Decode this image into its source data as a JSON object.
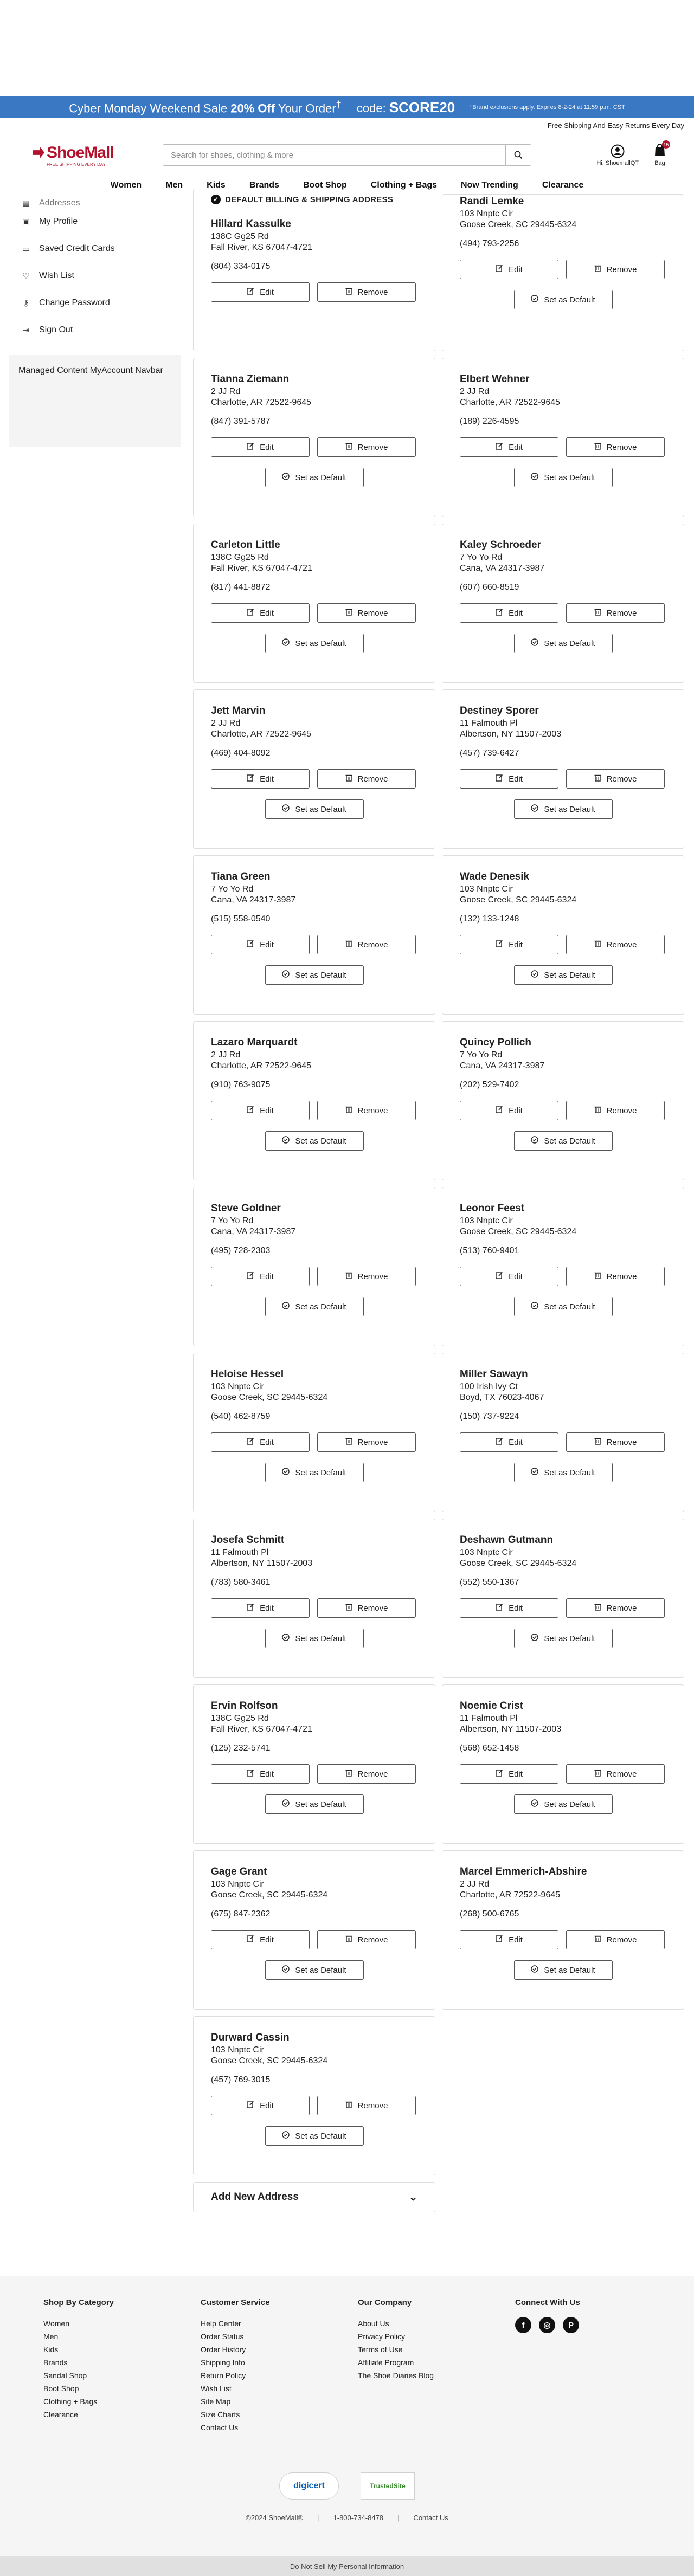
{
  "promo": {
    "sale": "Cyber Monday Weekend Sale",
    "pct": "20% Off",
    "order": "Your Order",
    "sup": "†",
    "code_label": "code:",
    "code": "SCORE20",
    "fine": "†Brand exclusions apply. Expires 8-2-24 at 11:59 p.m. CST"
  },
  "strip": {
    "right": "Free Shipping And Easy Returns Every Day"
  },
  "header": {
    "logo": "ShoeMall",
    "logo_tag": "FREE SHIPPING EVERY DAY",
    "search_placeholder": "Search for shoes, clothing & more",
    "account_label": "Hi, ShoemallQT",
    "bag_label": "Bag",
    "bag_count": "15"
  },
  "nav": [
    "Women",
    "Men",
    "Kids",
    "Brands",
    "Boot Shop",
    "Clothing + Bags",
    "Now Trending",
    "Clearance"
  ],
  "sidebar": {
    "partial_item": "Addresses",
    "items": [
      {
        "label": "My Profile",
        "icon": "profile-icon"
      },
      {
        "label": "Saved Credit Cards",
        "icon": "credit-card-icon"
      },
      {
        "label": "Wish List",
        "icon": "heart-icon"
      },
      {
        "label": "Change Password",
        "icon": "key-icon"
      },
      {
        "label": "Sign Out",
        "icon": "sign-out-icon"
      }
    ],
    "managed": "Managed Content MyAccount Navbar"
  },
  "labels": {
    "default_title": "DEFAULT BILLING & SHIPPING ADDRESS",
    "edit": "Edit",
    "remove": "Remove",
    "set_default": "Set as Default",
    "add_new": "Add New Address"
  },
  "addresses": [
    {
      "name": "Hillard Kassulke",
      "line1": "138C Gg25 Rd",
      "line2": "Fall River, KS 67047-4721",
      "phone": "(804) 334-0175",
      "is_default": true
    },
    {
      "name": "Randi Lemke",
      "line1": "103 Nnptc Cir",
      "line2": "Goose Creek, SC 29445-6324",
      "phone": "(494) 793-2256"
    },
    {
      "name": "Tianna Ziemann",
      "line1": "2 JJ Rd",
      "line2": "Charlotte, AR 72522-9645",
      "phone": "(847) 391-5787"
    },
    {
      "name": "Elbert Wehner",
      "line1": "2 JJ Rd",
      "line2": "Charlotte, AR 72522-9645",
      "phone": "(189) 226-4595"
    },
    {
      "name": "Carleton Little",
      "line1": "138C Gg25 Rd",
      "line2": "Fall River, KS 67047-4721",
      "phone": "(817) 441-8872"
    },
    {
      "name": "Kaley Schroeder",
      "line1": "7 Yo Yo Rd",
      "line2": "Cana, VA 24317-3987",
      "phone": "(607) 660-8519"
    },
    {
      "name": "Jett Marvin",
      "line1": "2 JJ Rd",
      "line2": "Charlotte, AR 72522-9645",
      "phone": "(469) 404-8092"
    },
    {
      "name": "Destiney Sporer",
      "line1": "11 Falmouth Pl",
      "line2": "Albertson, NY 11507-2003",
      "phone": "(457) 739-6427"
    },
    {
      "name": "Tiana Green",
      "line1": "7 Yo Yo Rd",
      "line2": "Cana, VA 24317-3987",
      "phone": "(515) 558-0540"
    },
    {
      "name": "Wade Denesik",
      "line1": "103 Nnptc Cir",
      "line2": "Goose Creek, SC 29445-6324",
      "phone": "(132) 133-1248"
    },
    {
      "name": "Lazaro Marquardt",
      "line1": "2 JJ Rd",
      "line2": "Charlotte, AR 72522-9645",
      "phone": "(910) 763-9075"
    },
    {
      "name": "Quincy Pollich",
      "line1": "7 Yo Yo Rd",
      "line2": "Cana, VA 24317-3987",
      "phone": "(202) 529-7402"
    },
    {
      "name": "Steve Goldner",
      "line1": "7 Yo Yo Rd",
      "line2": "Cana, VA 24317-3987",
      "phone": "(495) 728-2303"
    },
    {
      "name": "Leonor Feest",
      "line1": "103 Nnptc Cir",
      "line2": "Goose Creek, SC 29445-6324",
      "phone": "(513) 760-9401"
    },
    {
      "name": "Heloise Hessel",
      "line1": "103 Nnptc Cir",
      "line2": "Goose Creek, SC 29445-6324",
      "phone": "(540) 462-8759"
    },
    {
      "name": "Miller Sawayn",
      "line1": "100 Irish Ivy Ct",
      "line2": "Boyd, TX 76023-4067",
      "phone": "(150) 737-9224"
    },
    {
      "name": "Josefa Schmitt",
      "line1": "11 Falmouth Pl",
      "line2": "Albertson, NY 11507-2003",
      "phone": "(783) 580-3461"
    },
    {
      "name": "Deshawn Gutmann",
      "line1": "103 Nnptc Cir",
      "line2": "Goose Creek, SC 29445-6324",
      "phone": "(552) 550-1367"
    },
    {
      "name": "Ervin Rolfson",
      "line1": "138C Gg25 Rd",
      "line2": "Fall River, KS 67047-4721",
      "phone": "(125) 232-5741"
    },
    {
      "name": "Noemie Crist",
      "line1": "11 Falmouth Pl",
      "line2": "Albertson, NY 11507-2003",
      "phone": "(568) 652-1458"
    },
    {
      "name": "Gage Grant",
      "line1": "103 Nnptc Cir",
      "line2": "Goose Creek, SC 29445-6324",
      "phone": "(675) 847-2362"
    },
    {
      "name": "Marcel Emmerich-Abshire",
      "line1": "2 JJ Rd",
      "line2": "Charlotte, AR 72522-9645",
      "phone": "(268) 500-6765"
    },
    {
      "name": "Durward Cassin",
      "line1": "103 Nnptc Cir",
      "line2": "Goose Creek, SC 29445-6324",
      "phone": "(457) 769-3015"
    }
  ],
  "footer": {
    "cols": [
      {
        "title": "Shop By Category",
        "links": [
          "Women",
          "Men",
          "Kids",
          "Brands",
          "Sandal Shop",
          "Boot Shop",
          "Clothing + Bags",
          "Clearance"
        ]
      },
      {
        "title": "Customer Service",
        "links": [
          "Help Center",
          "Order Status",
          "Order History",
          "Shipping Info",
          "Return Policy",
          "Wish List",
          "Site Map",
          "Size Charts",
          "Contact Us"
        ]
      },
      {
        "title": "Our Company",
        "links": [
          "About Us",
          "Privacy Policy",
          "Terms of Use",
          "Affiliate Program",
          "The Shoe Diaries Blog"
        ]
      }
    ],
    "connect_title": "Connect With Us",
    "social": [
      {
        "icon": "facebook-icon",
        "glyph": "f"
      },
      {
        "icon": "instagram-icon",
        "glyph": "◎"
      },
      {
        "icon": "pinterest-icon",
        "glyph": "P"
      }
    ],
    "badge1": "digicert",
    "badge2": "TrustedSite",
    "copyright": "©2024 ShoeMall®",
    "phone": "1-800-734-8478",
    "contact": "Contact Us",
    "dns": "Do Not Sell My Personal Information"
  },
  "colors": {
    "promo_bg": "#3b78c3",
    "brand": "#b3122e"
  }
}
